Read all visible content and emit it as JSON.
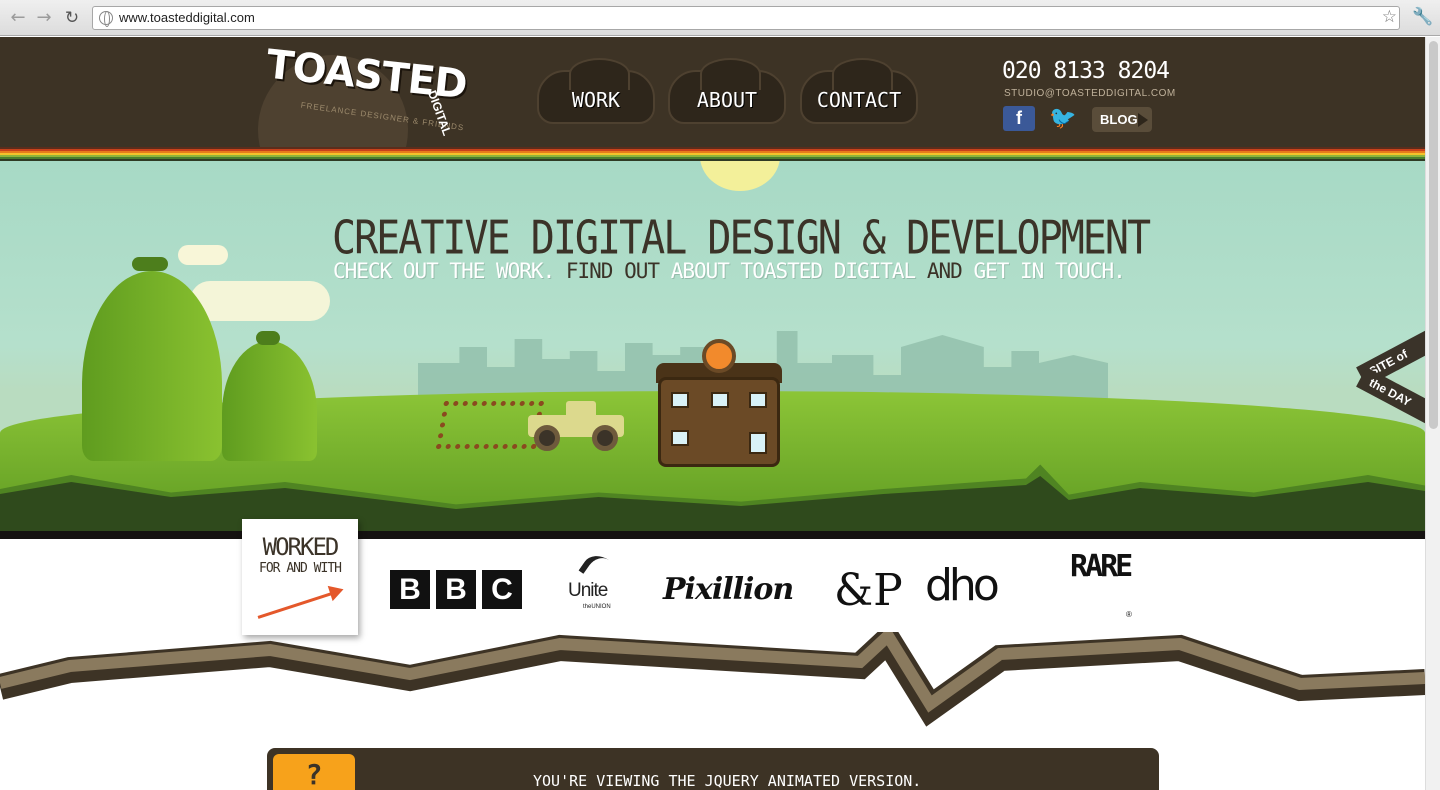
{
  "browser": {
    "url": "www.toasteddigital.com",
    "back_glyph": "←",
    "forward_glyph": "→",
    "reload_glyph": "↻",
    "star_glyph": "☆",
    "wrench_glyph": "🔧"
  },
  "header": {
    "logo_title": "TOASTED",
    "logo_suffix": "DIGITAL",
    "logo_tagline": "FREELANCE DESIGNER & FRIENDS",
    "nav": [
      {
        "label": "WORK"
      },
      {
        "label": "ABOUT"
      },
      {
        "label": "CONTACT"
      }
    ],
    "phone": "020 8133 8204",
    "email": "STUDIO@TOASTEDDIGITAL.COM",
    "facebook_glyph": "f",
    "twitter_glyph": "🐦",
    "blog_label": "BLOG"
  },
  "hero": {
    "headline": "CREATIVE DIGITAL DESIGN & DEVELOPMENT",
    "sub_parts": [
      {
        "text": "CHECK OUT THE WORK.",
        "link": true
      },
      {
        "text": "FIND OUT",
        "link": false
      },
      {
        "text": "ABOUT TOASTED DIGITAL",
        "link": true
      },
      {
        "text": "AND",
        "link": false
      },
      {
        "text": "GET IN TOUCH.",
        "link": true
      }
    ],
    "badge_top": "SITE of",
    "badge_bottom": "the DAY"
  },
  "clients": {
    "card_title": "WORKED",
    "card_sub": "FOR AND WITH",
    "bbc": [
      "B",
      "B",
      "C"
    ],
    "unite": "Unite",
    "unite_sub": "theUNION",
    "pixillion": "Pixillion",
    "ampersand": "&P",
    "dho": "dho",
    "rare": "RARE",
    "rare_mark": "®"
  },
  "notice": {
    "icon": "?",
    "text": "YOU'RE VIEWING THE JQUERY ANIMATED VERSION."
  },
  "colors": {
    "header_bg": "#3d3325",
    "accent_orange": "#f7a21b",
    "grass": "#8cc537",
    "sky": "#a7d9c5"
  }
}
